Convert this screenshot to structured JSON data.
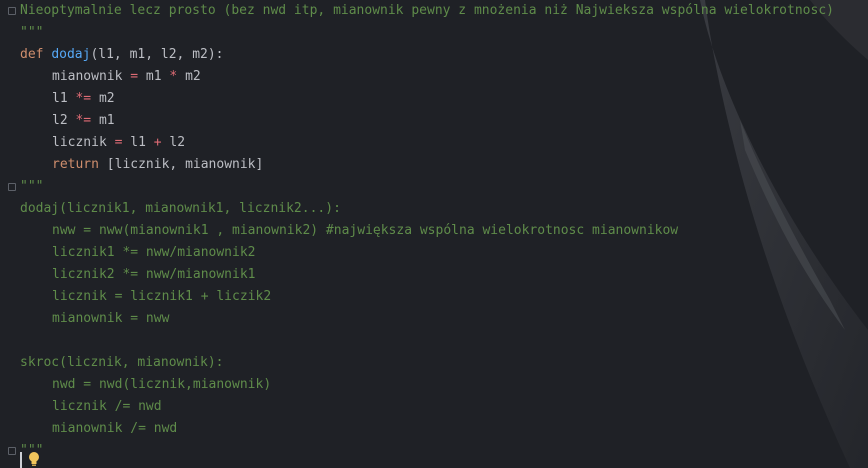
{
  "editor": {
    "lines": [
      {
        "type": "doc",
        "text": "Nieoptymalnie lecz prosto (bez nwd itp, mianownik pewny z mnożenia niż Najwieksza wspólna wielokrotnosc)"
      },
      {
        "type": "doc",
        "text": "\"\"\""
      },
      {
        "type": "code",
        "tokens": [
          {
            "t": "def ",
            "c": "kw"
          },
          {
            "t": "dodaj",
            "c": "fn"
          },
          {
            "t": "(l1, m1, l2, m2):",
            "c": "punc"
          }
        ]
      },
      {
        "type": "code",
        "indent": 1,
        "tokens": [
          {
            "t": "mianownik ",
            "c": "id"
          },
          {
            "t": "=",
            "c": "op"
          },
          {
            "t": " m1 ",
            "c": "id"
          },
          {
            "t": "*",
            "c": "op"
          },
          {
            "t": " m2",
            "c": "id"
          }
        ]
      },
      {
        "type": "code",
        "indent": 1,
        "tokens": [
          {
            "t": "l1 ",
            "c": "id"
          },
          {
            "t": "*=",
            "c": "op"
          },
          {
            "t": " m2",
            "c": "id"
          }
        ]
      },
      {
        "type": "code",
        "indent": 1,
        "tokens": [
          {
            "t": "l2 ",
            "c": "id"
          },
          {
            "t": "*=",
            "c": "op"
          },
          {
            "t": " m1",
            "c": "id"
          }
        ]
      },
      {
        "type": "code",
        "indent": 1,
        "tokens": [
          {
            "t": "licznik ",
            "c": "id"
          },
          {
            "t": "=",
            "c": "op"
          },
          {
            "t": " l1 ",
            "c": "id"
          },
          {
            "t": "+",
            "c": "op"
          },
          {
            "t": " l2",
            "c": "id"
          }
        ]
      },
      {
        "type": "code",
        "indent": 1,
        "tokens": [
          {
            "t": "return ",
            "c": "kw"
          },
          {
            "t": "[licznik, mianownik]",
            "c": "id"
          }
        ]
      },
      {
        "type": "doc",
        "text": "\"\"\""
      },
      {
        "type": "doc",
        "text": "dodaj(licznik1, mianownik1, licznik2...):"
      },
      {
        "type": "doc",
        "indent": 1,
        "text": "nww = nww(mianownik1 , mianownik2) #największa wspólna wielokrotnosc mianownikow"
      },
      {
        "type": "doc",
        "indent": 1,
        "text": "licznik1 *= nww/mianownik2"
      },
      {
        "type": "doc",
        "indent": 1,
        "text": "licznik2 *= nww/mianownik1"
      },
      {
        "type": "doc",
        "indent": 1,
        "text": "licznik = licznik1 + liczik2"
      },
      {
        "type": "doc",
        "indent": 1,
        "text": "mianownik = nww"
      },
      {
        "type": "doc",
        "text": ""
      },
      {
        "type": "doc",
        "text": "skroc(licznik, mianownik):"
      },
      {
        "type": "doc",
        "indent": 1,
        "text": "nwd = nwd(licznik,mianownik)"
      },
      {
        "type": "doc",
        "indent": 1,
        "text": "licznik /= nwd"
      },
      {
        "type": "doc",
        "indent": 1,
        "text": "mianownik /= nwd"
      },
      {
        "type": "doc",
        "text": "\"\"\""
      }
    ]
  },
  "icons": {
    "intention_bulb": "lightbulb-icon",
    "fold_marker": "fold-marker-icon"
  },
  "colors": {
    "background": "#1f2126",
    "docstring": "#5f8c4a",
    "keyword": "#cf8e6d",
    "function": "#56a8f5",
    "operator": "#e06c75",
    "identifier": "#bcbec4"
  }
}
